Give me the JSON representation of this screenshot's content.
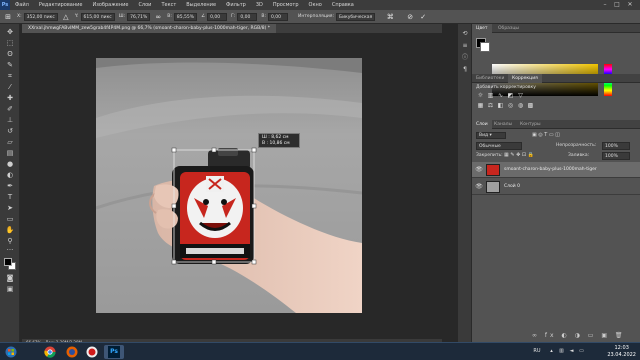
{
  "menubar": {
    "logo": "Ps",
    "items": [
      "Файл",
      "Редактирование",
      "Изображение",
      "Слои",
      "Текст",
      "Выделение",
      "Фильтр",
      "3D",
      "Просмотр",
      "Окно",
      "Справка"
    ]
  },
  "options": {
    "x_label": "X:",
    "x_value": "352,00 пикс",
    "y_label": "Y:",
    "y_value": "615,00 пикс",
    "w_label": "Ш:",
    "w_value": "76,71%",
    "h_label": "В:",
    "h_value": "85,55%",
    "angle_value": "0,00",
    "h_skew_label": "Г:",
    "h_skew_value": "0,00",
    "v_skew_label": "В:",
    "v_skew_value": "0,00",
    "interp_label": "Интерполяция:",
    "interp_value": "Бикубическая"
  },
  "document": {
    "tab_title": "XXrxal.jhmwgFABvIMM_zew5grab4f4P4M.png @ 66,7% (smoant-charon-baby-plus-1000mah-tiger, RGB/8) *"
  },
  "transform_tip": {
    "w_line": "Ш :   8,62 см",
    "h_line": "В :   10,86 см"
  },
  "statusbar": {
    "zoom": "66,67%",
    "doc": "Док: 2,30М/3,20М"
  },
  "panels": {
    "color_tabs": [
      "Цвет",
      "Образцы"
    ],
    "adjust_tabs": [
      "Библиотеки",
      "Коррекция"
    ],
    "adjust_hint": "Добавить корректировку",
    "layers_tabs": [
      "Слои",
      "Каналы",
      "Контуры"
    ],
    "kind_label": "Вид",
    "blend_mode": "Обычные",
    "opacity_label": "Непрозрачность:",
    "opacity_value": "100%",
    "lock_label": "Закрепить:",
    "fill_label": "Заливка:",
    "fill_value": "100%",
    "layers": [
      {
        "name": "smoant-charon-baby-plus-1000mah-tiger",
        "visible": true,
        "selected": true
      },
      {
        "name": "Слой 0",
        "visible": true,
        "selected": false
      }
    ]
  },
  "taskbar": {
    "lang": "RU",
    "time": "12:03",
    "date": "23.04.2022"
  },
  "colors": {
    "accent_orange": "#e7702a",
    "ps_blue": "#31a8ff",
    "device_red": "#c7261e"
  }
}
